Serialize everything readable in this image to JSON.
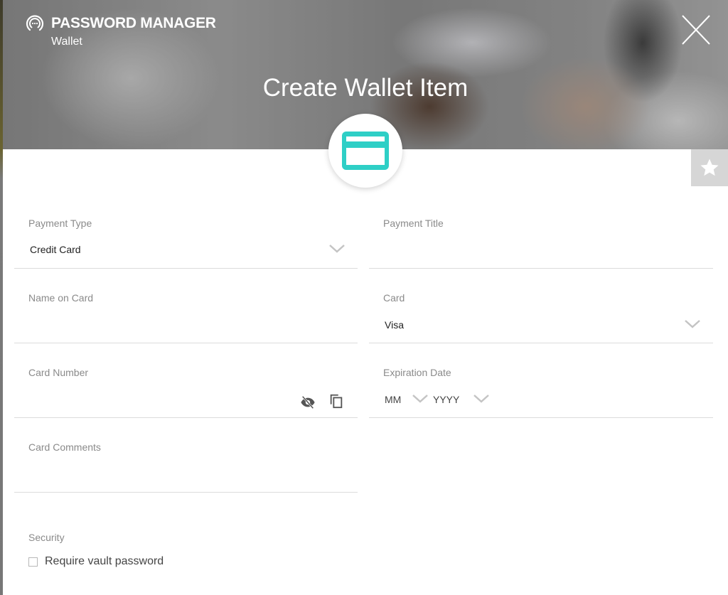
{
  "app": {
    "name": "PASSWORD MANAGER",
    "section": "Wallet"
  },
  "dialog": {
    "title": "Create Wallet Item",
    "item_type_icon": "credit-card-icon",
    "accent_color": "#2ecfc6",
    "close_icon": "close-icon",
    "favorite_icon": "star-icon"
  },
  "form": {
    "payment_type": {
      "label": "Payment Type",
      "value": "Credit Card"
    },
    "payment_title": {
      "label": "Payment Title",
      "value": ""
    },
    "name_on_card": {
      "label": "Name on Card",
      "value": ""
    },
    "card": {
      "label": "Card",
      "value": "Visa"
    },
    "card_number": {
      "label": "Card Number",
      "value": "",
      "toggle_icon": "eye-off-icon",
      "copy_icon": "copy-icon"
    },
    "expiration_date": {
      "label": "Expiration Date",
      "month": "MM",
      "year": "YYYY"
    },
    "card_comments": {
      "label": "Card Comments",
      "value": ""
    },
    "security": {
      "label": "Security",
      "require_vault_password": {
        "label": "Require vault password",
        "checked": false
      }
    }
  }
}
